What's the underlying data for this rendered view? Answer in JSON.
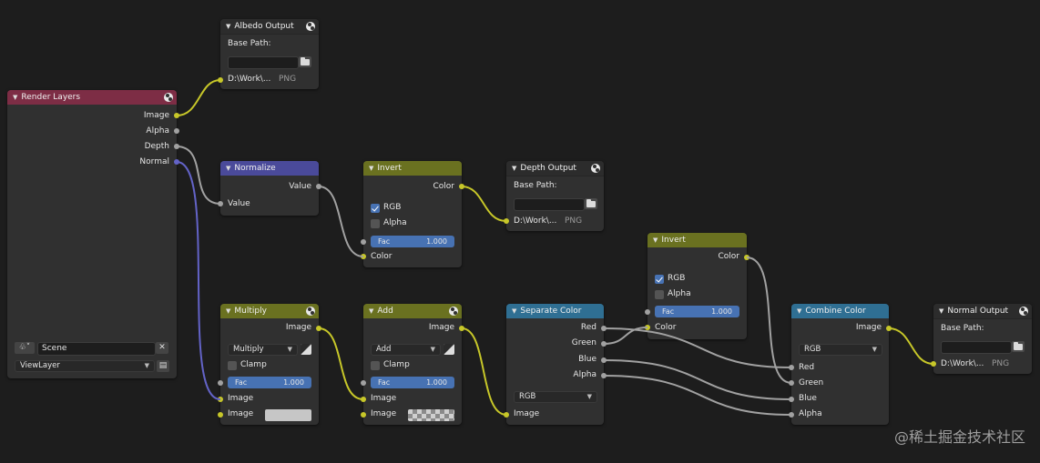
{
  "render_layers": {
    "title": "Render Layers",
    "outputs": [
      "Image",
      "Alpha",
      "Depth",
      "Normal"
    ],
    "scene_value": "Scene",
    "view_layer_value": "ViewLayer"
  },
  "albedo_output": {
    "title": "Albedo Output",
    "base_path_label": "Base Path:",
    "file_path": "D:\\Work\\...",
    "format": "PNG"
  },
  "depth_output": {
    "title": "Depth Output",
    "base_path_label": "Base Path:",
    "file_path": "D:\\Work\\...",
    "format": "PNG"
  },
  "normal_output": {
    "title": "Normal Output",
    "base_path_label": "Base Path:",
    "file_path": "D:\\Work\\...",
    "format": "PNG"
  },
  "normalize": {
    "title": "Normalize",
    "output": "Value",
    "input": "Value"
  },
  "invert_1": {
    "title": "Invert",
    "output": "Color",
    "rgb_label": "RGB",
    "alpha_label": "Alpha",
    "fac_label": "Fac",
    "fac_value": "1.000",
    "input": "Color",
    "rgb_checked": true,
    "alpha_checked": false
  },
  "invert_2": {
    "title": "Invert",
    "output": "Color",
    "rgb_label": "RGB",
    "alpha_label": "Alpha",
    "fac_label": "Fac",
    "fac_value": "1.000",
    "input": "Color",
    "rgb_checked": true,
    "alpha_checked": false
  },
  "multiply": {
    "title": "Multiply",
    "output": "Image",
    "mode": "Multiply",
    "clamp_label": "Clamp",
    "fac_label": "Fac",
    "fac_value": "1.000",
    "input1": "Image",
    "input2": "Image"
  },
  "add": {
    "title": "Add",
    "output": "Image",
    "mode": "Add",
    "clamp_label": "Clamp",
    "fac_label": "Fac",
    "fac_value": "1.000",
    "input1": "Image",
    "input2": "Image"
  },
  "separate_color": {
    "title": "Separate Color",
    "outputs": [
      "Red",
      "Green",
      "Blue",
      "Alpha"
    ],
    "mode": "RGB",
    "input": "Image"
  },
  "combine_color": {
    "title": "Combine Color",
    "output": "Image",
    "mode": "RGB",
    "inputs": [
      "Red",
      "Green",
      "Blue",
      "Alpha"
    ]
  },
  "watermark": "@稀土掘金技术社区",
  "colors": {
    "socket_color": "#c7c729",
    "socket_float": "#a1a1a1",
    "socket_vector": "#6363c7",
    "header_input": "#7d2d45",
    "header_converter": "#4a4a9a",
    "header_color": "#6a7120",
    "header_separate": "#2f6f93",
    "accent_blue": "#4772b3"
  }
}
